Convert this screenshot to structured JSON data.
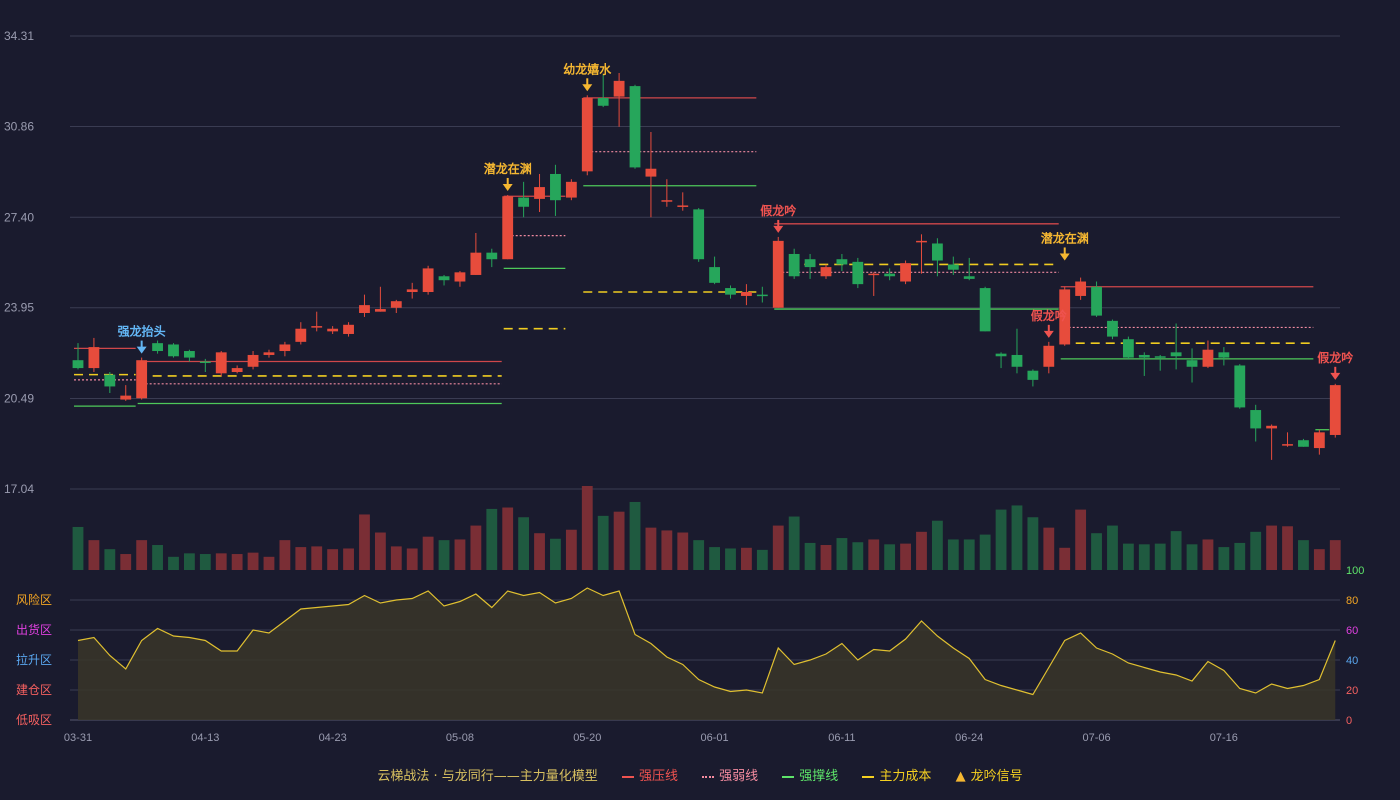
{
  "chart_data": {
    "type": "candlestick",
    "price_axis": {
      "ticks": [
        17.04,
        20.49,
        23.95,
        27.4,
        30.86,
        34.31
      ],
      "ylim": [
        17.04,
        34.31
      ]
    },
    "oscillator_axis": {
      "ticks": [
        0,
        20,
        40,
        60,
        80,
        100
      ],
      "ylim": [
        0,
        100
      ]
    },
    "zones": [
      "风险区",
      "出货区",
      "拉升区",
      "建仓区",
      "低吸区"
    ],
    "x_tick_labels": [
      {
        "i": 0,
        "label": "03-31"
      },
      {
        "i": 8,
        "label": "04-13"
      },
      {
        "i": 16,
        "label": "04-23"
      },
      {
        "i": 24,
        "label": "05-08"
      },
      {
        "i": 32,
        "label": "05-20"
      },
      {
        "i": 40,
        "label": "06-01"
      },
      {
        "i": 48,
        "label": "06-11"
      },
      {
        "i": 56,
        "label": "06-24"
      },
      {
        "i": 64,
        "label": "07-06"
      },
      {
        "i": 72,
        "label": "07-16"
      }
    ],
    "candles": [
      [
        21.95,
        21.65,
        22.6,
        21.6
      ],
      [
        21.65,
        22.45,
        22.8,
        21.5
      ],
      [
        21.4,
        20.95,
        21.5,
        20.7
      ],
      [
        20.45,
        20.6,
        21.0,
        20.4
      ],
      [
        20.5,
        21.95,
        22.05,
        20.45
      ],
      [
        22.6,
        22.3,
        22.7,
        22.2
      ],
      [
        22.55,
        22.1,
        22.6,
        22.05
      ],
      [
        22.3,
        22.05,
        22.35,
        21.9
      ],
      [
        21.9,
        21.85,
        22.0,
        21.5
      ],
      [
        21.45,
        22.25,
        22.3,
        21.35
      ],
      [
        21.5,
        21.65,
        21.75,
        21.45
      ],
      [
        21.7,
        22.15,
        22.3,
        21.6
      ],
      [
        22.15,
        22.25,
        22.35,
        22.05
      ],
      [
        22.3,
        22.55,
        22.65,
        22.1
      ],
      [
        22.65,
        23.15,
        23.4,
        22.55
      ],
      [
        23.2,
        23.25,
        23.8,
        23.05
      ],
      [
        23.05,
        23.15,
        23.25,
        22.95
      ],
      [
        22.95,
        23.3,
        23.4,
        22.85
      ],
      [
        23.75,
        24.05,
        24.45,
        23.6
      ],
      [
        23.8,
        23.9,
        24.75,
        23.8
      ],
      [
        23.95,
        24.2,
        24.25,
        23.75
      ],
      [
        24.55,
        24.65,
        24.9,
        24.3
      ],
      [
        24.55,
        25.45,
        25.55,
        24.45
      ],
      [
        25.15,
        25.0,
        25.2,
        24.8
      ],
      [
        24.95,
        25.3,
        25.35,
        24.75
      ],
      [
        25.2,
        26.05,
        26.8,
        25.2
      ],
      [
        26.05,
        25.8,
        26.2,
        25.5
      ],
      [
        25.8,
        28.2,
        28.25,
        25.8
      ],
      [
        28.15,
        27.8,
        28.75,
        27.4
      ],
      [
        28.1,
        28.55,
        29.05,
        27.6
      ],
      [
        29.05,
        28.05,
        29.4,
        27.45
      ],
      [
        28.15,
        28.75,
        28.85,
        28.05
      ],
      [
        29.15,
        31.95,
        32.05,
        29.0
      ],
      [
        31.95,
        31.65,
        32.85,
        31.6
      ],
      [
        32.0,
        32.6,
        32.9,
        30.85
      ],
      [
        32.4,
        29.3,
        32.45,
        29.25
      ],
      [
        28.95,
        29.25,
        30.65,
        27.4
      ],
      [
        28.05,
        28.05,
        28.85,
        27.8
      ],
      [
        27.85,
        27.85,
        28.35,
        27.65
      ],
      [
        27.7,
        25.8,
        27.75,
        25.7
      ],
      [
        25.5,
        24.9,
        25.9,
        24.85
      ],
      [
        24.7,
        24.45,
        24.8,
        24.3
      ],
      [
        24.4,
        24.55,
        24.85,
        24.05
      ],
      [
        24.45,
        24.4,
        24.75,
        24.15
      ],
      [
        23.95,
        26.5,
        26.65,
        23.95
      ],
      [
        26.0,
        25.15,
        26.2,
        25.05
      ],
      [
        25.8,
        25.5,
        26.0,
        25.05
      ],
      [
        25.15,
        25.5,
        25.6,
        25.05
      ],
      [
        25.8,
        25.6,
        26.0,
        25.35
      ],
      [
        25.7,
        24.85,
        25.85,
        24.7
      ],
      [
        25.2,
        25.25,
        25.3,
        24.4
      ],
      [
        25.25,
        25.15,
        25.45,
        25.0
      ],
      [
        24.95,
        25.65,
        25.75,
        24.85
      ],
      [
        26.45,
        26.5,
        26.75,
        25.25
      ],
      [
        26.4,
        25.75,
        26.6,
        25.15
      ],
      [
        25.6,
        25.4,
        25.9,
        25.2
      ],
      [
        25.15,
        25.05,
        25.85,
        25.0
      ],
      [
        24.7,
        23.05,
        24.75,
        23.05
      ],
      [
        22.2,
        22.1,
        22.25,
        21.65
      ],
      [
        22.15,
        21.7,
        23.15,
        21.45
      ],
      [
        21.55,
        21.2,
        21.6,
        20.95
      ],
      [
        21.7,
        22.5,
        22.65,
        21.45
      ],
      [
        22.55,
        24.65,
        24.75,
        22.5
      ],
      [
        24.4,
        24.95,
        25.1,
        24.25
      ],
      [
        24.75,
        23.65,
        24.95,
        23.6
      ],
      [
        23.45,
        22.85,
        23.5,
        22.75
      ],
      [
        22.75,
        22.05,
        22.85,
        22.0
      ],
      [
        22.15,
        22.05,
        22.25,
        21.35
      ],
      [
        22.1,
        22.05,
        22.15,
        21.55
      ],
      [
        22.25,
        22.1,
        23.35,
        21.6
      ],
      [
        21.95,
        21.7,
        22.4,
        21.1
      ],
      [
        21.7,
        22.35,
        22.7,
        21.65
      ],
      [
        22.25,
        22.05,
        22.45,
        21.75
      ],
      [
        21.75,
        20.15,
        21.8,
        20.1
      ],
      [
        20.05,
        19.35,
        20.25,
        18.85
      ],
      [
        19.35,
        19.45,
        19.5,
        18.15
      ],
      [
        18.75,
        18.75,
        19.2,
        18.65
      ],
      [
        18.9,
        18.65,
        18.95,
        18.65
      ],
      [
        18.6,
        19.2,
        19.3,
        18.35
      ],
      [
        19.1,
        21.0,
        21.05,
        19.0
      ]
    ],
    "volume": [
      62,
      43,
      30,
      23,
      43,
      36,
      19,
      24,
      23,
      24,
      23,
      25,
      19,
      43,
      33,
      34,
      30,
      31,
      80,
      54,
      34,
      31,
      48,
      43,
      44,
      64,
      88,
      90,
      76,
      53,
      45,
      58,
      121,
      78,
      84,
      98,
      61,
      57,
      54,
      43,
      33,
      31,
      32,
      29,
      64,
      77,
      39,
      36,
      46,
      40,
      44,
      37,
      38,
      55,
      71,
      44,
      44,
      51,
      87,
      93,
      76,
      61,
      32,
      87,
      53,
      64,
      38,
      37,
      38,
      56,
      37,
      44,
      33,
      39,
      55,
      64,
      63,
      43,
      30,
      43
    ],
    "oscillator": [
      53,
      55,
      43,
      34,
      53,
      61,
      56,
      55,
      53,
      46,
      46,
      60,
      58,
      66,
      74,
      75,
      76,
      77,
      83,
      78,
      80,
      81,
      86,
      76,
      79,
      84,
      75,
      86,
      83,
      85,
      78,
      81,
      88,
      83,
      86,
      57,
      51,
      42,
      37,
      27,
      22,
      19,
      20,
      18,
      48,
      37,
      40,
      44,
      51,
      40,
      47,
      46,
      54,
      66,
      56,
      48,
      41,
      27,
      23,
      20,
      17,
      35,
      53,
      58,
      48,
      44,
      38,
      35,
      32,
      30,
      26,
      39,
      33,
      21,
      18,
      24,
      21,
      23,
      27,
      53
    ],
    "resistance_segments": [
      [
        0,
        4,
        22.4
      ],
      [
        4,
        27,
        21.9
      ],
      [
        27,
        31,
        28.2
      ],
      [
        32,
        43,
        31.95
      ],
      [
        44,
        62,
        27.15
      ],
      [
        62,
        78,
        24.75
      ]
    ],
    "weak_segments": [
      [
        0,
        4,
        21.2
      ],
      [
        4,
        27,
        21.05
      ],
      [
        27,
        31,
        26.7
      ],
      [
        32,
        43,
        29.9
      ],
      [
        44,
        62,
        25.3
      ],
      [
        62,
        78,
        23.2
      ]
    ],
    "support_segments": [
      [
        0,
        4,
        20.2
      ],
      [
        4,
        27,
        20.3
      ],
      [
        27,
        31,
        25.45
      ],
      [
        32,
        43,
        28.6
      ],
      [
        44,
        62,
        23.9
      ],
      [
        62,
        78,
        22.0
      ],
      [
        78,
        79,
        19.3
      ]
    ],
    "cost_segments": [
      [
        0,
        4,
        21.4
      ],
      [
        4,
        27,
        21.35
      ],
      [
        27,
        31,
        23.15
      ],
      [
        32,
        43,
        24.55
      ],
      [
        44,
        62,
        25.6
      ],
      [
        62,
        78,
        22.6
      ]
    ],
    "signals": [
      {
        "i": 4,
        "label": "强龙抬头",
        "color": "#63b6f5",
        "anchor": 22.05
      },
      {
        "i": 27,
        "label": "潜龙在渊",
        "color": "#f5b731",
        "anchor": 28.25
      },
      {
        "i": 32,
        "label": "幼龙嬉水",
        "color": "#f5b731",
        "anchor": 32.05
      },
      {
        "i": 44,
        "label": "假龙吟",
        "color": "#ef5350",
        "anchor": 26.65
      },
      {
        "i": 61,
        "label": "假龙吟",
        "color": "#ef5350",
        "anchor": 22.65
      },
      {
        "i": 62,
        "label": "潜龙在渊",
        "color": "#f5b731",
        "anchor": 25.6
      },
      {
        "i": 79,
        "label": "假龙吟",
        "color": "#ef5350",
        "anchor": 21.05
      }
    ],
    "legend": [
      {
        "label": "云梯战法 · 与龙同行——主力量化模型",
        "type": "text"
      },
      {
        "label": "强压线",
        "type": "solid",
        "color": "#ef5350"
      },
      {
        "label": "强弱线",
        "type": "dotted",
        "color": "#f58ca0"
      },
      {
        "label": "强撑线",
        "type": "solid",
        "color": "#5ee46a"
      },
      {
        "label": "主力成本",
        "type": "dashed",
        "color": "#f5d020"
      },
      {
        "label": "龙吟信号",
        "type": "triangle",
        "color": "#f5b731"
      }
    ],
    "colors": {
      "up": "#e74c3c",
      "down": "#26a65b",
      "grid": "#3a3c52",
      "axis_text": "#9a9cb0",
      "oscillator_line": "#e0c030",
      "zone_risk": "#f5a623",
      "zone_sell": "#e040e0",
      "zone_rise": "#5aa7f0",
      "zone_build": "#f56060",
      "zone_low": "#f56060"
    }
  }
}
